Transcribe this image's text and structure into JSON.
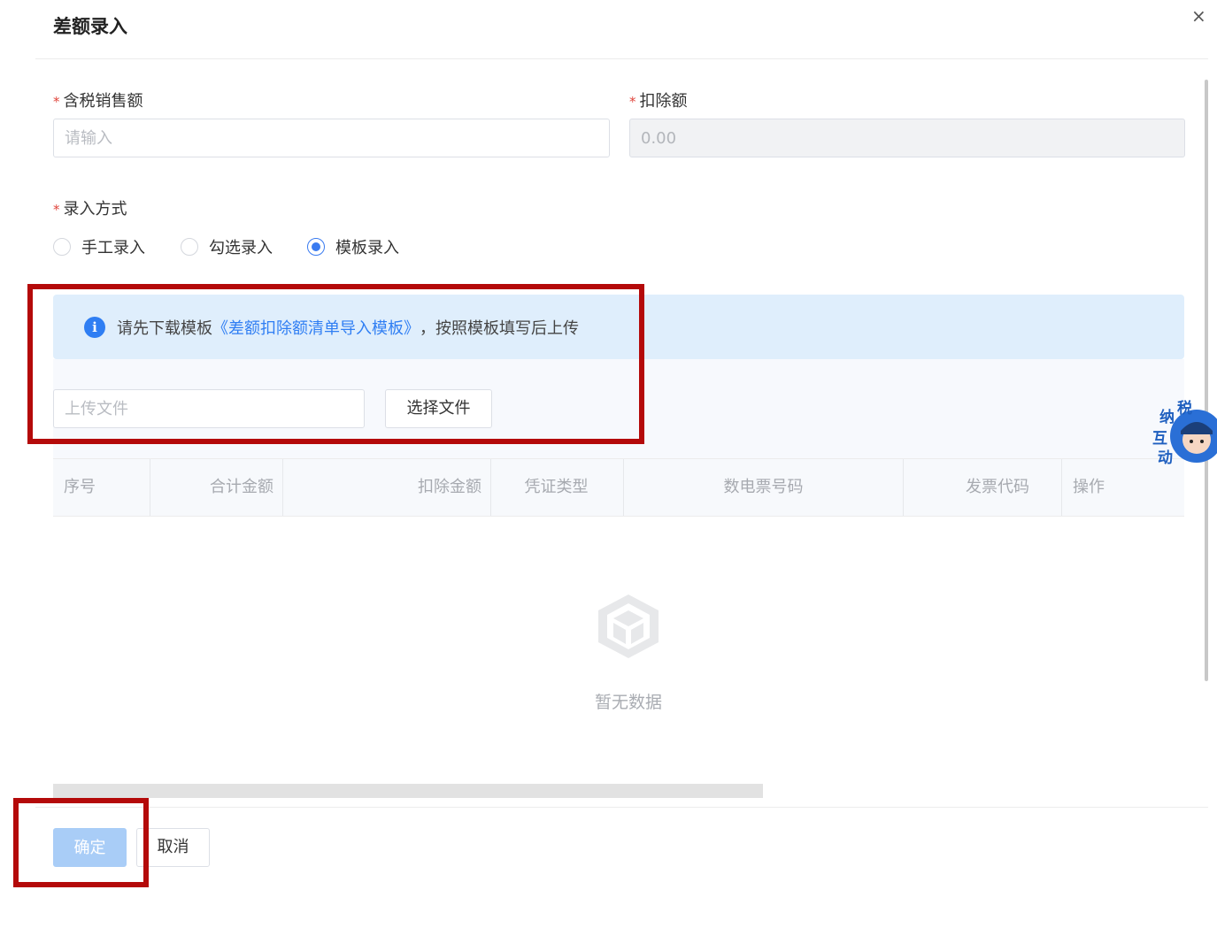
{
  "dialog": {
    "title": "差额录入",
    "close_symbol": "×"
  },
  "form": {
    "sales_amount": {
      "label": "含税销售额",
      "required_mark": "*",
      "placeholder": "请输入",
      "value": ""
    },
    "deduction": {
      "label": "扣除额",
      "required_mark": "*",
      "value": "0.00"
    },
    "entry_mode": {
      "label": "录入方式",
      "required_mark": "*",
      "options": [
        "手工录入",
        "勾选录入",
        "模板录入"
      ],
      "selected": "模板录入"
    }
  },
  "info": {
    "icon": "info-icon",
    "icon_glyph": "i",
    "prefix": "请先下载模板",
    "link": "《差额扣除额清单导入模板》",
    "suffix": "，按照模板填写后上传"
  },
  "upload": {
    "placeholder": "上传文件",
    "button_label": "选择文件"
  },
  "table": {
    "columns": [
      "序号",
      "合计金额",
      "扣除金额",
      "凭证类型",
      "数电票号码",
      "发票代码",
      "操作"
    ],
    "empty_text": "暂无数据"
  },
  "mascot": {
    "chars": [
      "纳",
      "税",
      "互",
      "动"
    ]
  },
  "footer": {
    "confirm_label": "确定",
    "cancel_label": "取消"
  },
  "colors": {
    "primary": "#2f7ef3",
    "required": "#e0453c",
    "highlight": "#b40a0a",
    "confirm_disabled": "#a9cdf7"
  }
}
